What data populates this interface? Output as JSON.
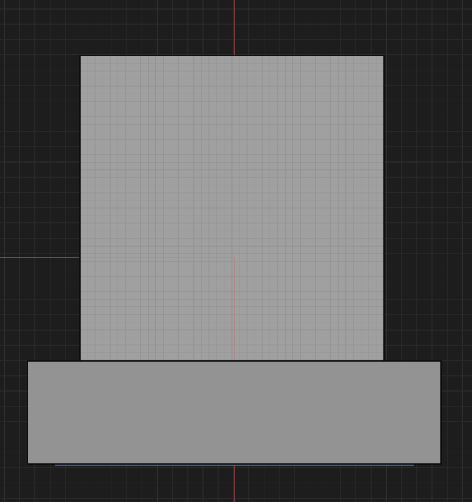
{
  "viewport": {
    "view": "front-orthographic",
    "background_color": "#1d1d1d",
    "grid_minor_color": "#2a2a2a",
    "grid_major_color": "#303030",
    "axis_x_color": "#d05a5a",
    "axis_y_color": "#5cae5c",
    "axis_z_color": "#4a6fb0"
  },
  "objects": [
    {
      "name": "upper-box",
      "face_color": "#a0a0a0",
      "face_grid_color": "#949494",
      "outline_color": "#0a0a0a",
      "shows_face_grid": true
    },
    {
      "name": "base-slab",
      "face_color": "#939393",
      "outline_color": "#0a0a0a",
      "shows_face_grid": false
    }
  ]
}
